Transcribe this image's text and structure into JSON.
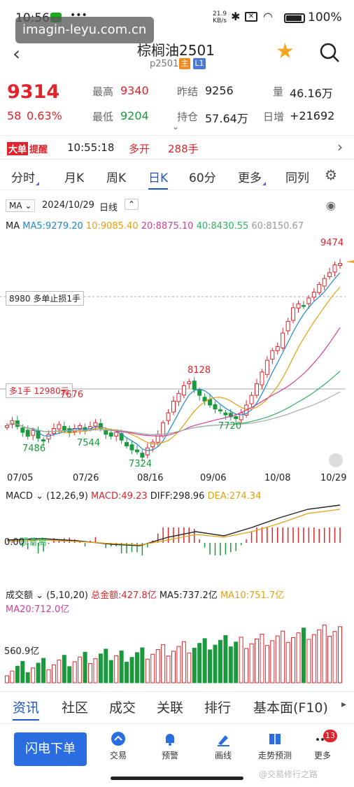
{
  "status": {
    "time": "10:56",
    "net": "21.9",
    "net_unit": "KB/s",
    "battery": "100%"
  },
  "watermark": "imagin-leyu.com.cn",
  "header": {
    "title": "棕榈油2501",
    "code": "p2501",
    "badge_main": "主",
    "badge_l1": "L1"
  },
  "quote": {
    "price": "9314",
    "change": "58",
    "change_pct": "0.63%",
    "high_label": "最高",
    "high": "9340",
    "low_label": "最低",
    "low": "9204",
    "prev_label": "昨结",
    "prev": "9256",
    "oi_label": "持仓",
    "oi": "57.64万",
    "vol_label": "量",
    "vol": "46.16万",
    "day_inc_label": "日增",
    "day_inc": "+21692"
  },
  "alert": {
    "badge1": "大单",
    "badge2": "提醒",
    "time": "10:55:18",
    "action": "多开",
    "size": "288手"
  },
  "tabs": [
    "分时",
    "月K",
    "周K",
    "日K",
    "60分",
    "更多",
    "同列"
  ],
  "chart_header": {
    "indicator": "MA",
    "date": "2024/10/29",
    "period": "日线"
  },
  "ma_row": {
    "label": "MA",
    "ma5": "MA5:9279.20",
    "ma10": "10:9085.40",
    "ma20": "20:8875.10",
    "ma40": "40:8430.55",
    "ma60": "60:8150.67"
  },
  "annotations": {
    "stop": "8980  多单止损1手",
    "long": "多1手  12980元",
    "high": "9474",
    "p8128": "8128",
    "p7720": "7720",
    "p7486": "7486",
    "p7544": "7544",
    "p7324": "7324",
    "p7676": "7676"
  },
  "dates": [
    "07/05",
    "07/26",
    "08/16",
    "09/06",
    "10/08",
    "10/29"
  ],
  "macd": {
    "label": "MACD",
    "params": "(12,26,9)",
    "macd": "MACD:49.23",
    "diff": "DIFF:298.96",
    "dea": "DEA:274.34",
    "zero": "0.00",
    "note": "顶背离"
  },
  "volume": {
    "label": "成交额",
    "params": "(5,10,20)",
    "total": "总金额:427.8亿",
    "ma5": "MA5:737.2亿",
    "ma10": "MA10:751.7亿",
    "ma20": "MA20:712.0亿",
    "level": "560.9亿"
  },
  "bottom_tabs": [
    "资讯",
    "社区",
    "成交",
    "关联",
    "排行",
    "基本面(F10)"
  ],
  "toolbar": {
    "flash": "闪电下单",
    "trade": "交易",
    "warn": "预警",
    "draw": "画线",
    "trend": "走势预测",
    "more": "更多",
    "badge": "13"
  },
  "footer_mark": "@交易修行之路",
  "colors": {
    "up": "#e0242b",
    "down": "#1a9a3c",
    "accent": "#1e57c9"
  },
  "chart_data": {
    "type": "candlestick",
    "x_labels": [
      "07/05",
      "07/26",
      "08/16",
      "09/06",
      "10/08",
      "10/29"
    ],
    "closes": [
      7650,
      7700,
      7640,
      7580,
      7540,
      7600,
      7520,
      7490,
      7560,
      7620,
      7660,
      7600,
      7580,
      7620,
      7650,
      7600,
      7640,
      7680,
      7620,
      7560,
      7540,
      7580,
      7500,
      7440,
      7400,
      7380,
      7324,
      7420,
      7480,
      7560,
      7680,
      7780,
      7900,
      7980,
      8060,
      8100,
      8020,
      7960,
      7900,
      7860,
      7820,
      7800,
      7760,
      7740,
      7720,
      7780,
      7860,
      7960,
      8080,
      8200,
      8320,
      8420,
      8460,
      8600,
      8720,
      8860,
      8900,
      8880,
      8960,
      9020,
      9100,
      9160,
      9220,
      9300,
      9314
    ]
  }
}
